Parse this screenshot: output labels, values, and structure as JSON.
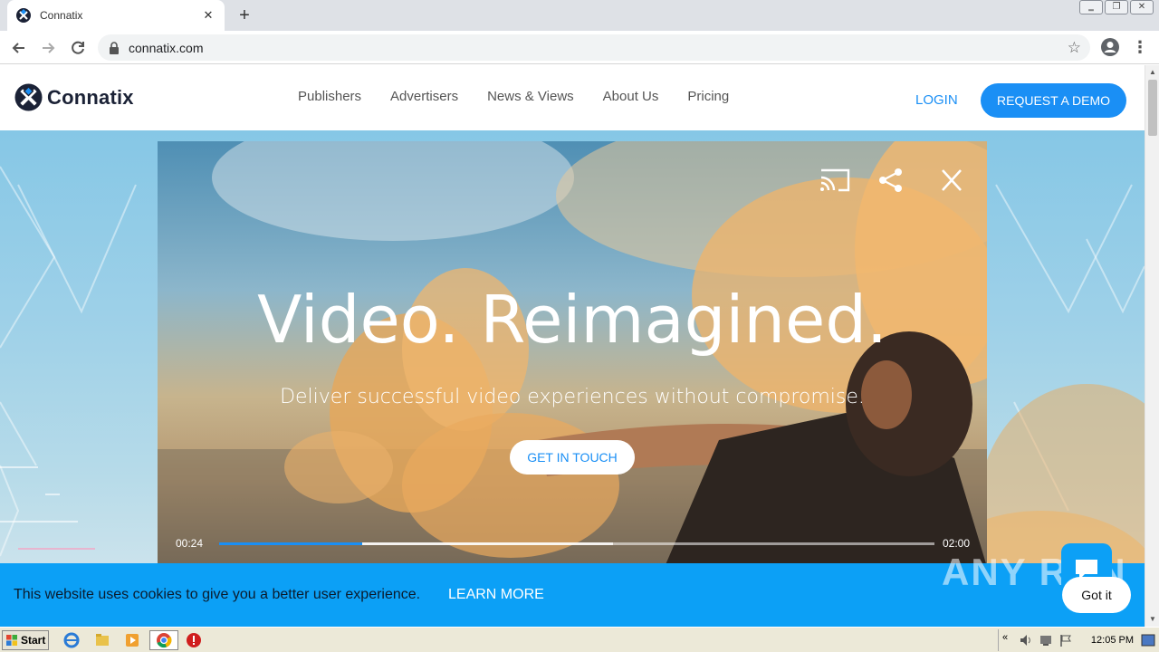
{
  "browser": {
    "tab_title": "Connatix",
    "tab_close": "✕",
    "new_tab": "+",
    "url": "connatix.com",
    "window_controls": [
      "‗",
      "❐",
      "✕"
    ]
  },
  "site": {
    "brand": "Connatix",
    "nav": [
      "Publishers",
      "Advertisers",
      "News & Views",
      "About Us",
      "Pricing"
    ],
    "login_label": "LOGIN",
    "demo_label": "REQUEST A DEMO",
    "accent_color": "#1a8ff5"
  },
  "hero": {
    "headline": "Video. Reimagined.",
    "subline": "Deliver successful video experiences without compromise.",
    "cta_label": "GET IN TOUCH"
  },
  "player": {
    "current_time": "00:24",
    "duration": "02:00",
    "progress_fraction": 0.2,
    "buffered_fraction": 0.55,
    "controls": [
      "cast-icon",
      "share-icon",
      "close-icon"
    ]
  },
  "cookie": {
    "message": "This website uses cookies to give you a better user experience.",
    "learn_more": "LEARN MORE",
    "accept_label": "Got it"
  },
  "watermark": "ANY RUN",
  "taskbar": {
    "start_label": "Start",
    "clock": "12:05 PM"
  }
}
